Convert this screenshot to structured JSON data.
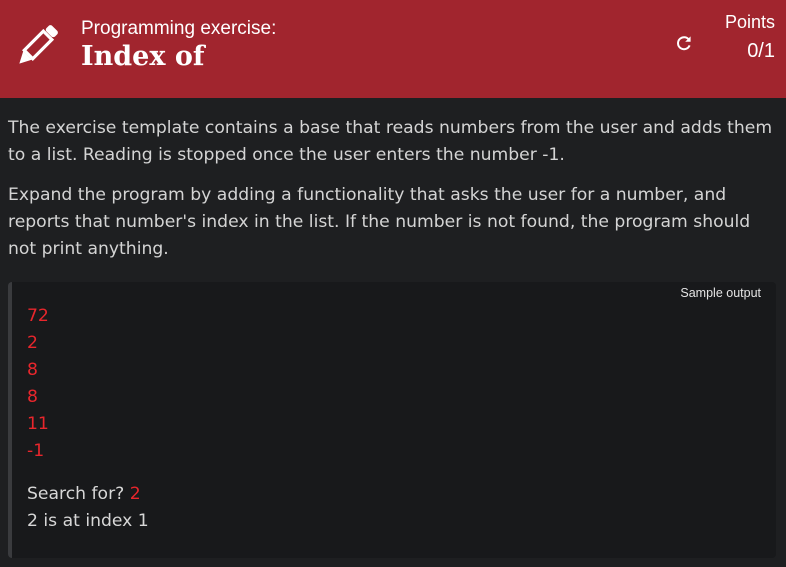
{
  "header": {
    "subtitle": "Programming exercise:",
    "title": "Index of",
    "points_label": "Points",
    "points_value": "0/1",
    "refresh_icon": "refresh-icon",
    "pencil_icon": "pencil-icon",
    "background_color": "#a1252e"
  },
  "description": {
    "paragraphs": [
      "The exercise template contains a base that reads numbers from the user and adds them to a list. Reading is stopped once the user enters the number -1.",
      "Expand the program by adding a functionality that asks the user for a number, and reports that number's index in the list. If the number is not found, the program should not print anything."
    ]
  },
  "sample_output": {
    "label": "Sample output",
    "inputs": [
      "72",
      "2",
      "8",
      "8",
      "11",
      "-1"
    ],
    "prompt": "Search for? ",
    "prompt_input": "2",
    "result": "2 is at index 1",
    "input_color": "#e8262c"
  }
}
